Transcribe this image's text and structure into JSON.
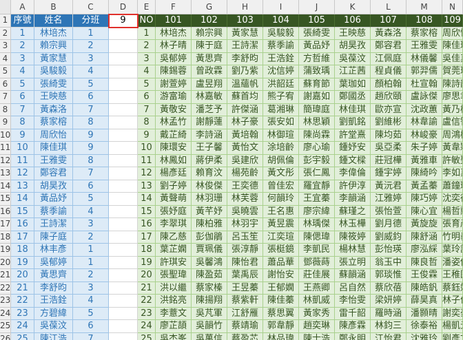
{
  "columns": [
    "A",
    "B",
    "C",
    "D",
    "E",
    "F",
    "G",
    "H",
    "I",
    "J",
    "K",
    "L",
    "M",
    "N"
  ],
  "rows": [
    "1",
    "2",
    "3",
    "4",
    "5",
    "6",
    "7",
    "8",
    "9",
    "10",
    "11",
    "12",
    "13",
    "14",
    "15",
    "16",
    "17",
    "18",
    "19",
    "20",
    "21",
    "22",
    "23",
    "24",
    "25",
    "26"
  ],
  "left_table": {
    "headers": [
      "序號",
      "姓名",
      "分班"
    ],
    "rows": [
      [
        "1",
        "林培杰",
        "1"
      ],
      [
        "2",
        "賴宗興",
        "2"
      ],
      [
        "3",
        "黃家慧",
        "3"
      ],
      [
        "4",
        "吳駿毅",
        "4"
      ],
      [
        "5",
        "張綺雯",
        "5"
      ],
      [
        "6",
        "王映慈",
        "6"
      ],
      [
        "7",
        "黃森洛",
        "7"
      ],
      [
        "8",
        "蔡家榕",
        "8"
      ],
      [
        "9",
        "周欣怡",
        "9"
      ],
      [
        "10",
        "陳佳琪",
        "9"
      ],
      [
        "11",
        "王雅雯",
        "8"
      ],
      [
        "12",
        "鄭容君",
        "7"
      ],
      [
        "13",
        "胡昊孜",
        "6"
      ],
      [
        "14",
        "黃品妤",
        "5"
      ],
      [
        "15",
        "蔡季諭",
        "4"
      ],
      [
        "16",
        "王詩潔",
        "3"
      ],
      [
        "17",
        "陳子庭",
        "2"
      ],
      [
        "18",
        "林丰彥",
        "1"
      ],
      [
        "19",
        "吳郁婷",
        "1"
      ],
      [
        "20",
        "黃思齊",
        "2"
      ],
      [
        "21",
        "李舒昀",
        "3"
      ],
      [
        "22",
        "王浩銓",
        "4"
      ],
      [
        "23",
        "方碧緯",
        "5"
      ],
      [
        "24",
        "吳葆汶",
        "6"
      ],
      [
        "25",
        "陳江浩",
        "7"
      ]
    ]
  },
  "d1_value": "9",
  "right_table": {
    "no_label": "NO",
    "headers": [
      "101",
      "102",
      "103",
      "104",
      "105",
      "106",
      "107",
      "108",
      "109"
    ],
    "rows": [
      [
        "1",
        "林培杰",
        "賴宗興",
        "黃家慧",
        "吳駿毅",
        "張綺雯",
        "王映慈",
        "黃森洛",
        "蔡家榕",
        "周欣怡"
      ],
      [
        "2",
        "林子晴",
        "陳于庭",
        "王詩潔",
        "蔡季諭",
        "黃品妤",
        "胡昊孜",
        "鄭容君",
        "王雅雯",
        "陳佳琪"
      ],
      [
        "3",
        "吳郁婷",
        "黃思齊",
        "李舒昀",
        "王浩銓",
        "方哲維",
        "吳葆汶",
        "江佩庭",
        "林儀馨",
        "吳佳真"
      ],
      [
        "4",
        "陳錫蓉",
        "曾政霖",
        "劉乃紫",
        "沈信婷",
        "蒲致瑀",
        "江芷茜",
        "程貞儀",
        "郭羿儒",
        "賀莞玲"
      ],
      [
        "5",
        "謝萱婷",
        "盧昱翔",
        "溫蘊帆",
        "洪韶廷",
        "蘇育節",
        "葉珈如",
        "顏柏翰",
        "杜宣翰",
        "陳詩韵"
      ],
      [
        "6",
        "游富瑜",
        "林嘉敏",
        "蘇首均",
        "熊子宥",
        "謝嘉如",
        "鄭國丞",
        "趙欣頤",
        "盧詠傑",
        "廖思聿"
      ],
      [
        "7",
        "黃敬安",
        "潘芝予",
        "許傑涵",
        "葛湘琳",
        "簡瑋庭",
        "林佳琪",
        "歐亦宣",
        "沈政蕙",
        "黃乃榕"
      ],
      [
        "8",
        "林孟竹",
        "謝靜蓮",
        "林子豪",
        "張安如",
        "林思穎",
        "劉凱銘",
        "劉維彬",
        "林韋諭",
        "盧信智"
      ],
      [
        "9",
        "戴芷綺",
        "李詩涵",
        "黃培翰",
        "林御瑄",
        "陳尚霖",
        "許堂熹",
        "陳均茹",
        "林峻豪",
        "周鴻彬"
      ],
      [
        "10",
        "陳環安",
        "王子馨",
        "黃怡文",
        "涂培齡",
        "廖心瑜",
        "鍾妤安",
        "吳亞柔",
        "朱子婷",
        "黃韋穎"
      ],
      [
        "11",
        "林鳳如",
        "蔣伊柔",
        "吳建欣",
        "胡佩倫",
        "彭宇毅",
        "鍾文樑",
        "莊冠樺",
        "黃雅車",
        "許敏聖"
      ],
      [
        "12",
        "楊彥廷",
        "賴育汶",
        "楊苑齡",
        "黃文彤",
        "張仁鳳",
        "李偉倫",
        "鍾宇婷",
        "陳綺吟",
        "李如真"
      ],
      [
        "13",
        "劉子婷",
        "林俊傑",
        "王奕德",
        "曾佳宏",
        "羅宜靜",
        "許伊淳",
        "黃沅君",
        "黃孟蓁",
        "蕭鐘璇"
      ],
      [
        "14",
        "黃聲萌",
        "林羽珊",
        "林芙蓉",
        "何韻玲",
        "王宜蓁",
        "李韻涵",
        "江雅婷",
        "陳巧婷",
        "沈奕德"
      ],
      [
        "15",
        "張妤庭",
        "黃芊妤",
        "吳曉雲",
        "王名惠",
        "廖宗緯",
        "蘇瑾之",
        "張怡萱",
        "陳心宜",
        "楊哲勳"
      ],
      [
        "16",
        "李翠琪",
        "陳柏雅",
        "林羽宇",
        "黃昱震",
        "林瑀傑",
        "林玉樺",
        "劉月德",
        "黃旋旋",
        "張育彥"
      ],
      [
        "17",
        "陳乙慈",
        "彭伽鵑",
        "呂玉笙",
        "江奕瑄",
        "陳偲瑋",
        "陳筱婷",
        "劉威鈞",
        "陳舒涵",
        "竹明義"
      ],
      [
        "18",
        "葉芷嫻",
        "賈珮儀",
        "張淳靜",
        "張梃鏡",
        "李凱民",
        "楊林慧",
        "彭怡瑛",
        "廖泓綵",
        "葉玲詩"
      ],
      [
        "19",
        "許琪安",
        "吳馨鴻",
        "陳怡君",
        "蕭品華",
        "鄧薇蒔",
        "張立明",
        "翁玉中",
        "陳良哲",
        "潘姿儀"
      ],
      [
        "20",
        "張聖瑋",
        "陳盈茹",
        "葉禹辰",
        "謝怡安",
        "莊佳展",
        "蘇韻涵",
        "郭琰惟",
        "王俊霖",
        "王稚囿"
      ],
      [
        "21",
        "洪以繼",
        "蔡家榛",
        "王昱蓁",
        "王郁嫻",
        "王燕卿",
        "呂自然",
        "蔡欣蓓",
        "陳皓釩",
        "蔡鈺婷"
      ],
      [
        "22",
        "洪銘亮",
        "陳揚翔",
        "蔡紫軒",
        "陳佳蓁",
        "林凱威",
        "李怡雯",
        "梁妍婷",
        "薛昊真",
        "林子佳"
      ],
      [
        "23",
        "李薏文",
        "吳芃軍",
        "江舒雁",
        "蔡思翼",
        "黃家秀",
        "雷千韶",
        "羅時涵",
        "潘顥晴",
        "謝奕豪"
      ],
      [
        "24",
        "廖芷頡",
        "吳韻竹",
        "蔡靖瑜",
        "郭韋靜",
        "趙奕琳",
        "陳彥霖",
        "林鈞三",
        "徐泰裕",
        "楊凱元"
      ],
      [
        "25",
        "吳杰峯",
        "吳萬信",
        "蔡盈芯",
        "林品瑋",
        "陳士浩",
        "鄭永明",
        "江怡君",
        "沈雅玲",
        "劉彥文"
      ]
    ]
  }
}
